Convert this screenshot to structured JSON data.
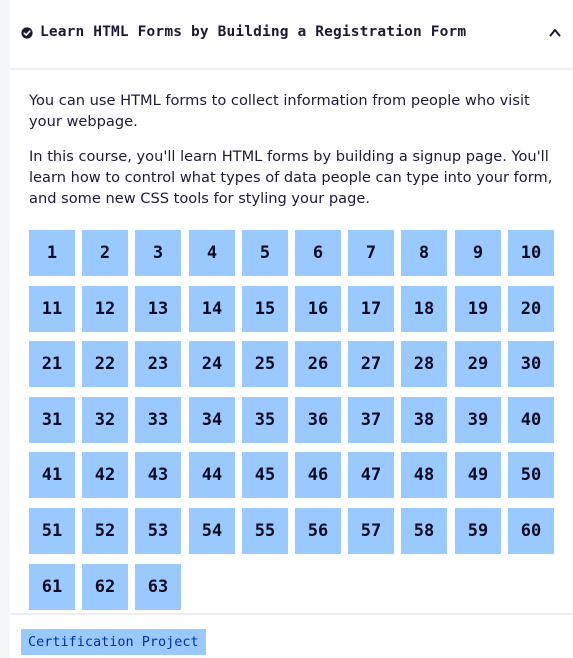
{
  "section": {
    "title": "Learn HTML Forms by Building a Registration Form",
    "status_icon": "check-circle-icon",
    "toggle_icon": "caret-up-icon",
    "expanded": true,
    "description": [
      "You can use HTML forms to collect information from people who visit your webpage.",
      "In this course, you'll learn HTML forms by building a signup page. You'll learn how to control what types of data people can type into your form, and some new CSS tools for styling your page."
    ]
  },
  "steps": [
    "1",
    "2",
    "3",
    "4",
    "5",
    "6",
    "7",
    "8",
    "9",
    "10",
    "11",
    "12",
    "13",
    "14",
    "15",
    "16",
    "17",
    "18",
    "19",
    "20",
    "21",
    "22",
    "23",
    "24",
    "25",
    "26",
    "27",
    "28",
    "29",
    "30",
    "31",
    "32",
    "33",
    "34",
    "35",
    "36",
    "37",
    "38",
    "39",
    "40",
    "41",
    "42",
    "43",
    "44",
    "45",
    "46",
    "47",
    "48",
    "49",
    "50",
    "51",
    "52",
    "53",
    "54",
    "55",
    "56",
    "57",
    "58",
    "59",
    "60",
    "61",
    "62",
    "63"
  ],
  "footer": {
    "badge_label": "Certification Project"
  },
  "colors": {
    "step_fill": "#99c9ff",
    "step_text": "#0a0a23",
    "badge_text": "#002ead",
    "divider": "#eeeff2"
  }
}
